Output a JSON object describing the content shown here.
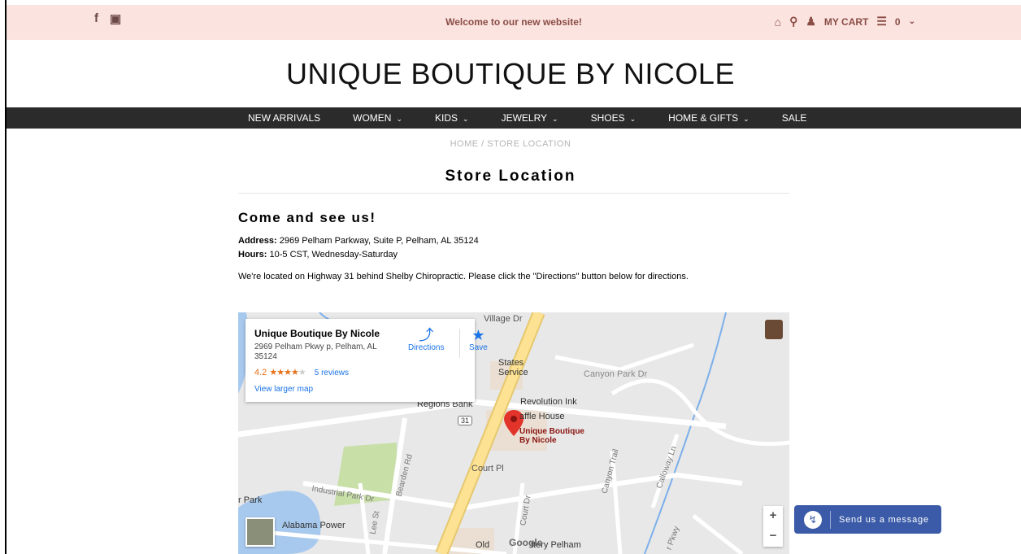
{
  "topbar": {
    "welcome": "Welcome to our new website!",
    "cart_label": "MY CART",
    "cart_count": "0"
  },
  "logo": "UNIQUE BOUTIQUE BY NICOLE",
  "nav": {
    "items": [
      {
        "label": "NEW ARRIVALS",
        "caret": false
      },
      {
        "label": "WOMEN",
        "caret": true
      },
      {
        "label": "KIDS",
        "caret": true
      },
      {
        "label": "JEWELRY",
        "caret": true
      },
      {
        "label": "SHOES",
        "caret": true
      },
      {
        "label": "HOME & GIFTS",
        "caret": true
      },
      {
        "label": "SALE",
        "caret": false
      }
    ]
  },
  "breadcrumb": "HOME / STORE LOCATION",
  "page_title": "Store Location",
  "content": {
    "heading": "Come and see us!",
    "address_label": "Address:",
    "address": "2969 Pelham Parkway, Suite P, Pelham, AL 35124",
    "hours_label": "Hours:",
    "hours": "10-5 CST, Wednesday-Saturday",
    "note": "We're located on Highway 31 behind Shelby Chiropractic. Please click the \"Directions\" button below for directions."
  },
  "map": {
    "card": {
      "name": "Unique Boutique By Nicole",
      "address": "2969 Pelham Pkwy p, Pelham, AL 35124",
      "rating": "4.2",
      "reviews": "5 reviews",
      "larger": "View larger map",
      "directions": "Directions",
      "save": "Save"
    },
    "labels": {
      "village": "Village Dr",
      "states": "States",
      "service": "Service",
      "canyon_park": "Canyon Park Dr",
      "regions": "Regions Bank",
      "revolution": "Revolution Ink",
      "waffle": "affle House",
      "pin1": "Unique Boutique",
      "pin2": "By Nicole",
      "court_pl": "Court Pl",
      "bearden": "Bearden Rd",
      "industrial": "Industrial Park Dr",
      "park": "r Park",
      "alabama": "Alabama Power",
      "lee": "Lee St",
      "court_dr": "Court Dr",
      "canyon_trail": "Canyon Trail",
      "calloway": "Calloway Ln",
      "old": "Old",
      "pottery": "ttery Pelham",
      "pkwy": "r Pkwy",
      "hwy": "31"
    },
    "google": "Google"
  },
  "messenger": "Send us a message"
}
